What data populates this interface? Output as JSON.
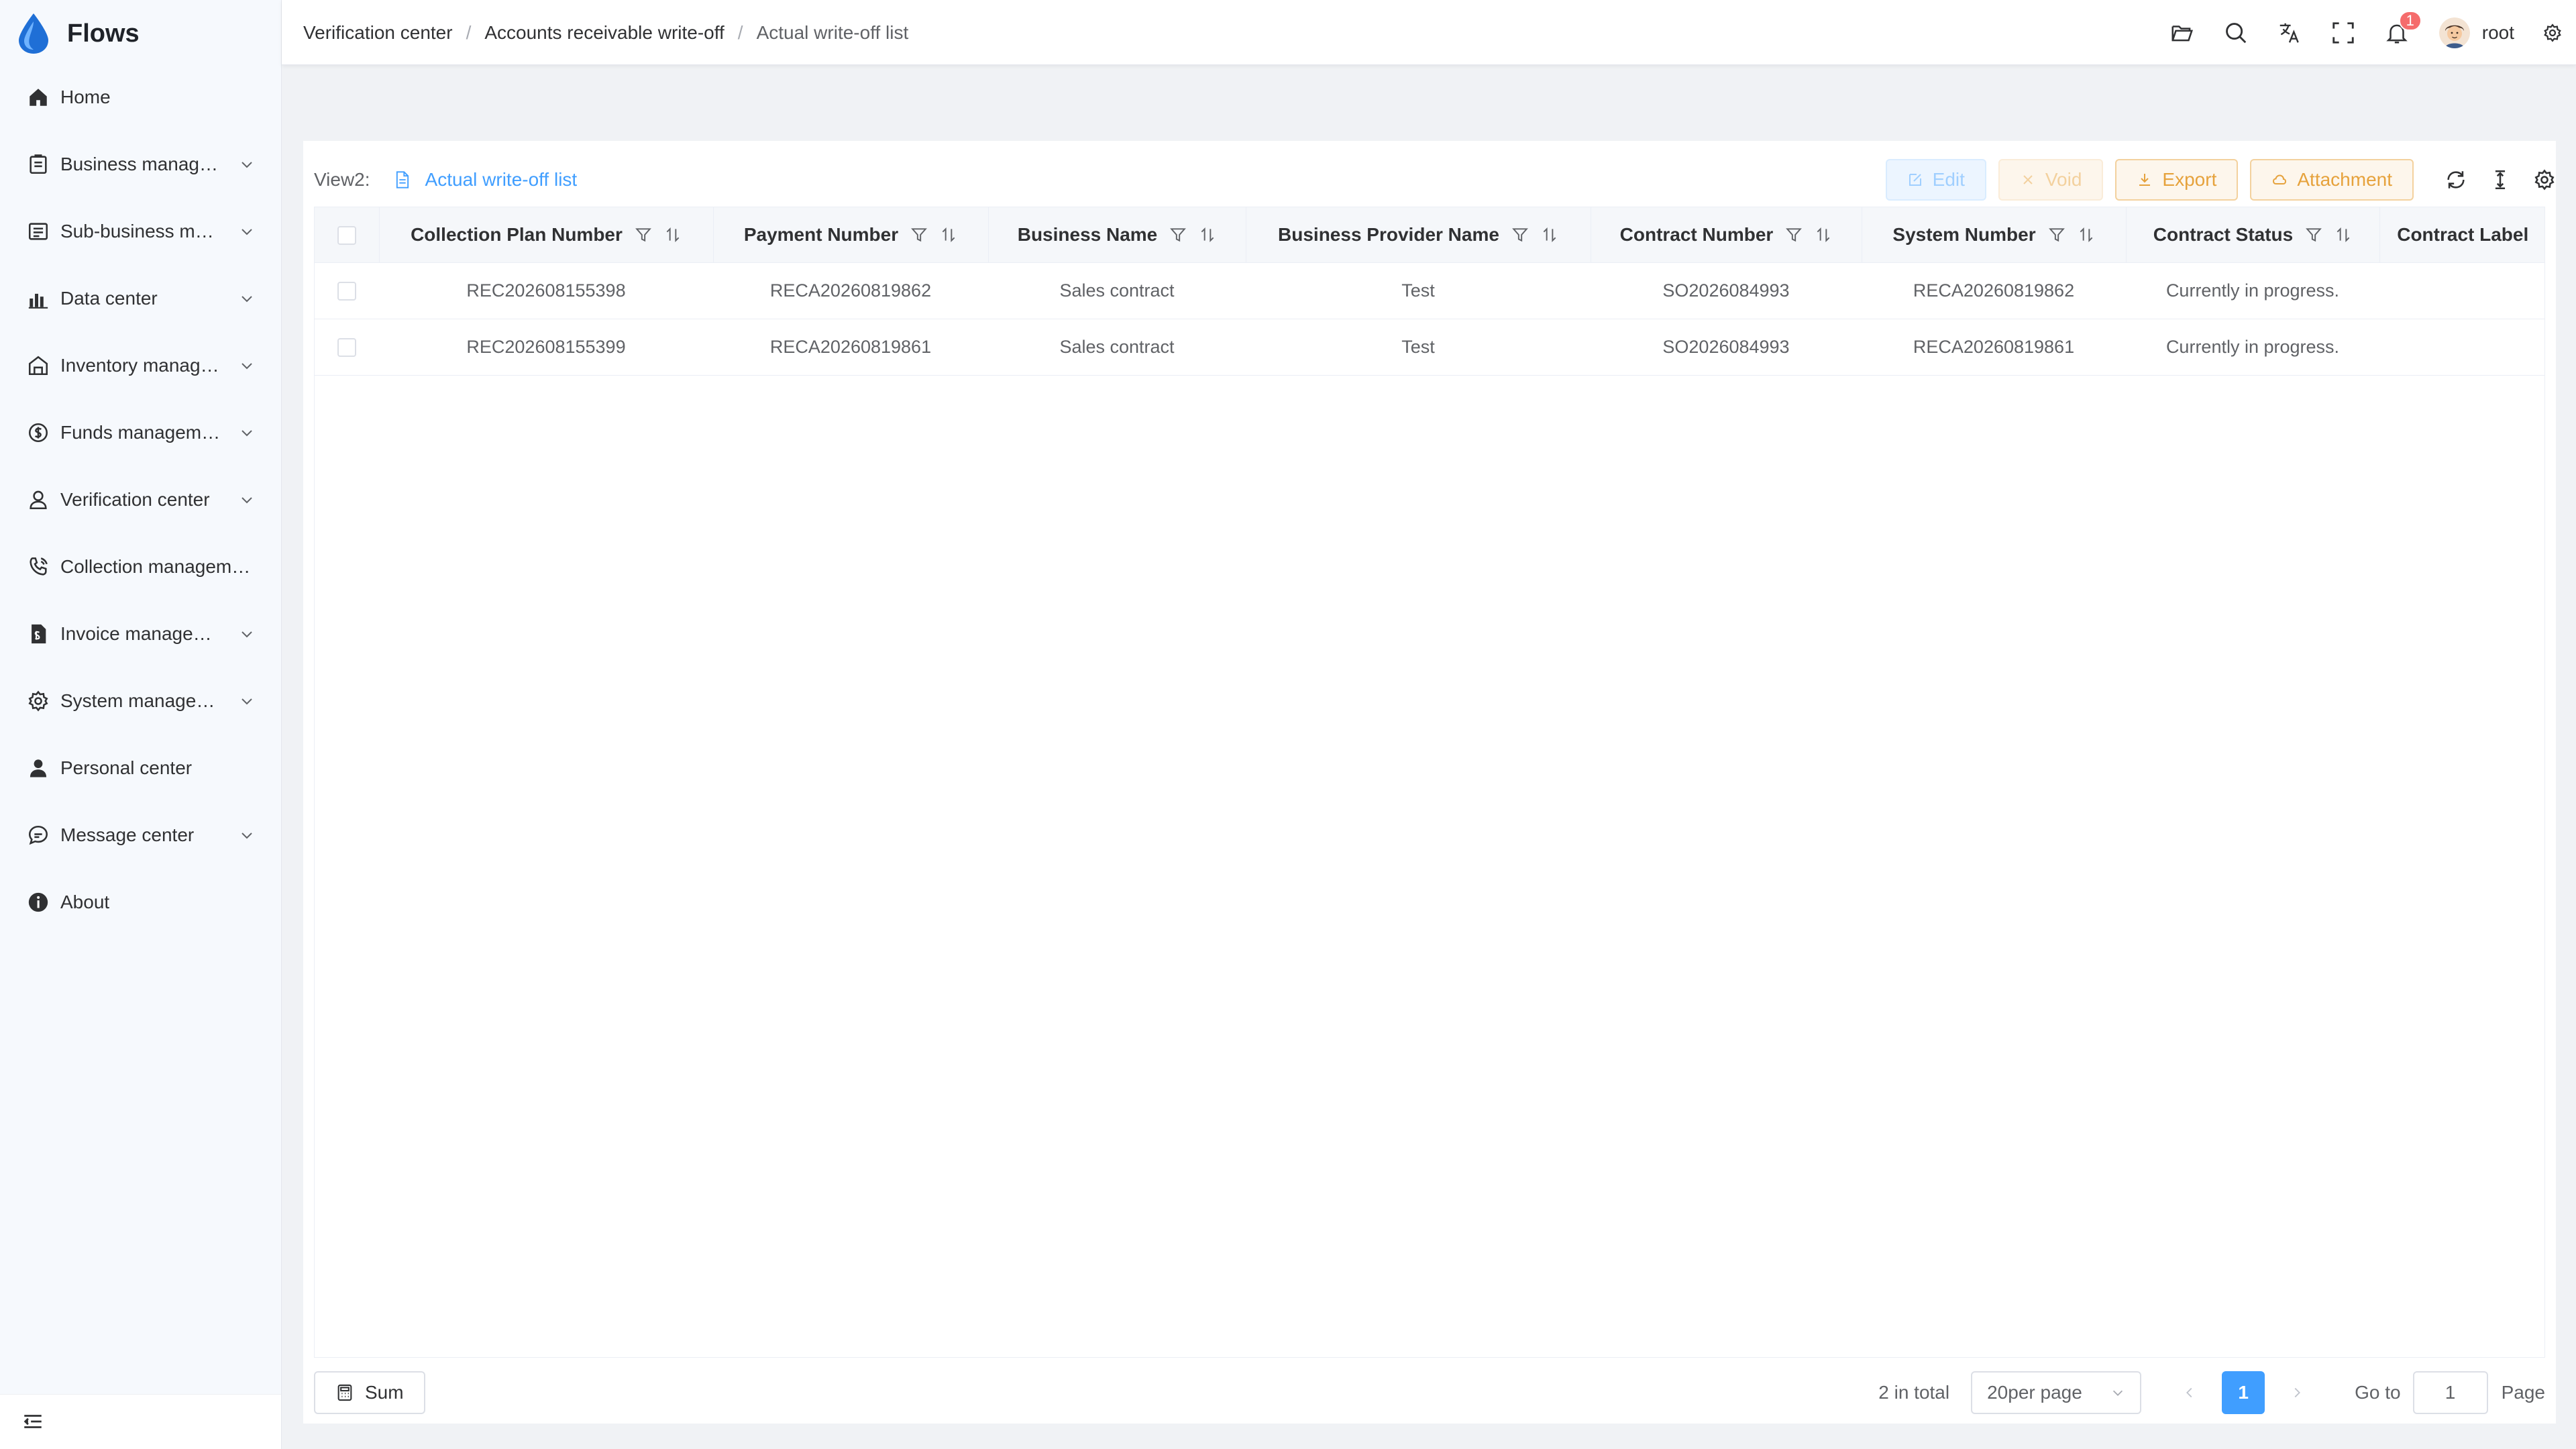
{
  "app": {
    "title": "Flows"
  },
  "sidebar": {
    "items": [
      {
        "label": "Home",
        "icon": "home-icon",
        "expandable": false
      },
      {
        "label": "Business manag…",
        "icon": "briefcase-icon",
        "expandable": true
      },
      {
        "label": "Sub-business m…",
        "icon": "document-list-icon",
        "expandable": true
      },
      {
        "label": "Data center",
        "icon": "bar-chart-icon",
        "expandable": true
      },
      {
        "label": "Inventory manag…",
        "icon": "warehouse-icon",
        "expandable": true
      },
      {
        "label": "Funds managem…",
        "icon": "dollar-circle-icon",
        "expandable": true
      },
      {
        "label": "Verification center",
        "icon": "user-check-icon",
        "expandable": true
      },
      {
        "label": "Collection managem…",
        "icon": "phone-icon",
        "expandable": false
      },
      {
        "label": "Invoice manage…",
        "icon": "invoice-icon",
        "expandable": true
      },
      {
        "label": "System manage…",
        "icon": "gear-icon",
        "expandable": true
      },
      {
        "label": "Personal center",
        "icon": "person-icon",
        "expandable": false
      },
      {
        "label": "Message center",
        "icon": "chat-bubble-icon",
        "expandable": true
      },
      {
        "label": "About",
        "icon": "info-icon",
        "expandable": false
      }
    ]
  },
  "header": {
    "breadcrumb": [
      "Verification center",
      "Accounts receivable write-off",
      "Actual write-off list"
    ],
    "separator": "/",
    "notifications_count": "1",
    "username": "root"
  },
  "view": {
    "label": "View2:",
    "name": "Actual write-off list"
  },
  "toolbar": {
    "edit": "Edit",
    "void": "Void",
    "export": "Export",
    "attachment": "Attachment"
  },
  "table": {
    "columns": [
      "Collection Plan Number",
      "Payment Number",
      "Business Name",
      "Business Provider Name",
      "Contract Number",
      "System Number",
      "Contract Status",
      "Contract Label"
    ],
    "rows": [
      [
        "REC202608155398",
        "RECA20260819862",
        "Sales contract",
        "Test",
        "SO2026084993",
        "RECA20260819862",
        "Currently in progress.",
        ""
      ],
      [
        "REC202608155399",
        "RECA20260819861",
        "Sales contract",
        "Test",
        "SO2026084993",
        "RECA20260819861",
        "Currently in progress.",
        ""
      ]
    ]
  },
  "footer": {
    "sum_label": "Sum",
    "total_text": "2 in total",
    "page_size": "20per page",
    "current_page": "1",
    "goto_label": "Go to",
    "goto_value": "1",
    "page_word": "Page"
  },
  "colors": {
    "primary": "#409eff",
    "warning": "#e6a23c",
    "danger": "#f56c6c",
    "sidebar_bg": "#f6f9fd",
    "page_bg": "#f0f2f5"
  }
}
